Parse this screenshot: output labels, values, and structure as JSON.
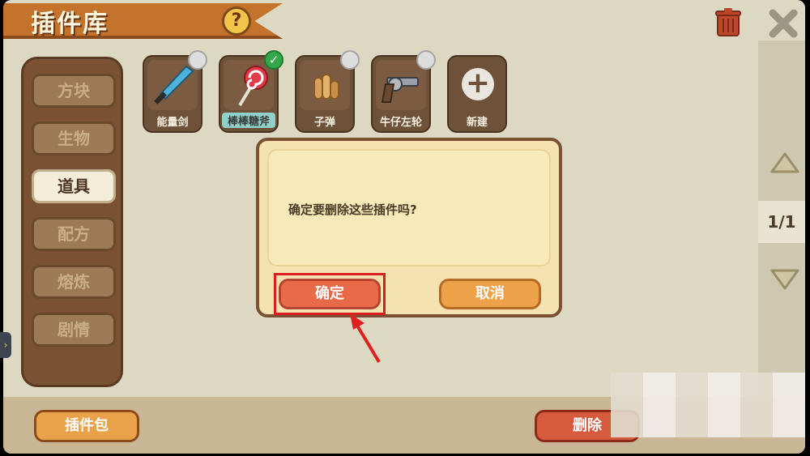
{
  "header": {
    "title": "插件库",
    "help_symbol": "?"
  },
  "sidebar": {
    "categories": [
      {
        "label": "方块",
        "active": false
      },
      {
        "label": "生物",
        "active": false
      },
      {
        "label": "道具",
        "active": true
      },
      {
        "label": "配方",
        "active": false
      },
      {
        "label": "熔炼",
        "active": false
      },
      {
        "label": "剧情",
        "active": false
      }
    ]
  },
  "plugins": [
    {
      "label": "能量剑",
      "icon": "sword-icon",
      "checked": false
    },
    {
      "label": "棒棒糖斧",
      "icon": "lollipop-icon",
      "checked": true
    },
    {
      "label": "子弹",
      "icon": "bullets-icon",
      "checked": false
    },
    {
      "label": "牛仔左轮",
      "icon": "revolver-icon",
      "checked": false
    },
    {
      "label": "新建",
      "icon": "plus-icon"
    }
  ],
  "pager": {
    "page": "1/1"
  },
  "bottom": {
    "package_label": "插件包",
    "delete_label": "删除"
  },
  "dialog": {
    "message": "确定要删除这些插件吗?",
    "confirm_label": "确定",
    "cancel_label": "取消"
  },
  "colors": {
    "accent": "#c4732c",
    "highlight": "#d81e1e",
    "confirm": "#e86a48",
    "cancel": "#eda24a"
  }
}
